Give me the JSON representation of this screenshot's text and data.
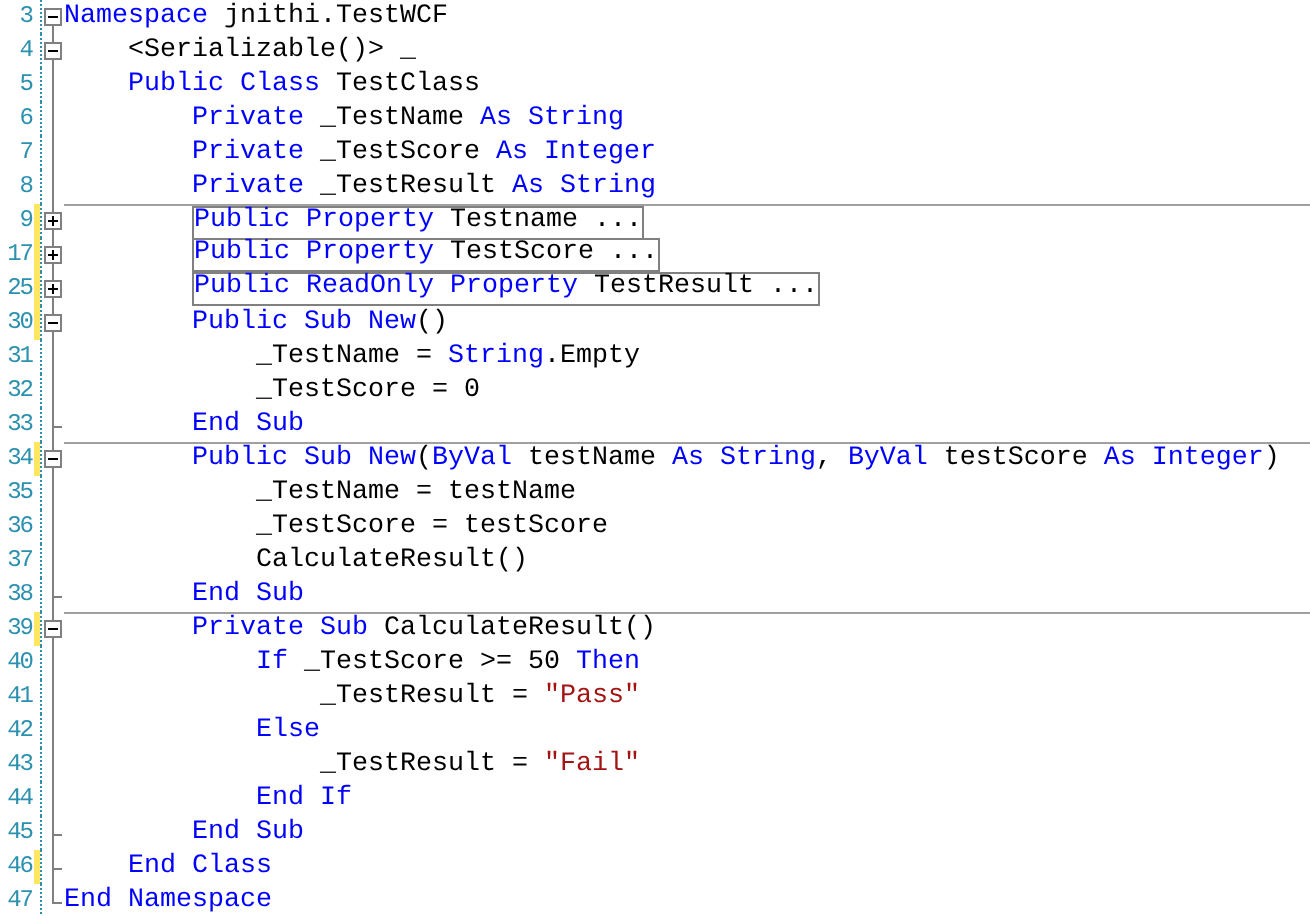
{
  "editor": {
    "lines": [
      {
        "number": "3",
        "kind": "open",
        "modified": false,
        "divider": false,
        "collapsed": false,
        "tokens": [
          {
            "kind": "keyword",
            "text": "Namespace"
          },
          {
            "kind": "plain",
            "text": " jnithi.TestWCF"
          }
        ]
      },
      {
        "number": "4",
        "kind": "open",
        "modified": false,
        "divider": false,
        "collapsed": false,
        "tokens": [
          {
            "kind": "plain",
            "text": "    <Serializable()> _"
          }
        ]
      },
      {
        "number": "5",
        "kind": "plain",
        "modified": false,
        "divider": false,
        "collapsed": false,
        "tokens": [
          {
            "kind": "keyword",
            "text": "    Public Class"
          },
          {
            "kind": "plain",
            "text": " TestClass"
          }
        ]
      },
      {
        "number": "6",
        "kind": "plain",
        "modified": false,
        "divider": false,
        "collapsed": false,
        "tokens": [
          {
            "kind": "keyword",
            "text": "        Private"
          },
          {
            "kind": "plain",
            "text": " _TestName "
          },
          {
            "kind": "keyword",
            "text": "As String"
          }
        ]
      },
      {
        "number": "7",
        "kind": "plain",
        "modified": false,
        "divider": false,
        "collapsed": false,
        "tokens": [
          {
            "kind": "keyword",
            "text": "        Private"
          },
          {
            "kind": "plain",
            "text": " _TestScore "
          },
          {
            "kind": "keyword",
            "text": "As Integer"
          }
        ]
      },
      {
        "number": "8",
        "kind": "plain",
        "modified": false,
        "divider": false,
        "collapsed": false,
        "tokens": [
          {
            "kind": "keyword",
            "text": "        Private"
          },
          {
            "kind": "plain",
            "text": " _TestResult "
          },
          {
            "kind": "keyword",
            "text": "As String"
          }
        ]
      },
      {
        "number": "9",
        "kind": "closed",
        "modified": true,
        "divider": true,
        "collapsed": true,
        "tokens": [
          {
            "kind": "keyword",
            "text": "        Public Property"
          },
          {
            "kind": "plain",
            "text": " Testname ..."
          }
        ]
      },
      {
        "number": "17",
        "kind": "closed",
        "modified": true,
        "divider": false,
        "collapsed": true,
        "tokens": [
          {
            "kind": "keyword",
            "text": "        Public Property"
          },
          {
            "kind": "plain",
            "text": " TestScore ..."
          }
        ]
      },
      {
        "number": "25",
        "kind": "closed",
        "modified": true,
        "divider": false,
        "collapsed": true,
        "tokens": [
          {
            "kind": "keyword",
            "text": "        Public ReadOnly Property"
          },
          {
            "kind": "plain",
            "text": " TestResult ..."
          }
        ]
      },
      {
        "number": "30",
        "kind": "open",
        "modified": true,
        "divider": false,
        "collapsed": false,
        "tokens": [
          {
            "kind": "keyword",
            "text": "        Public Sub New"
          },
          {
            "kind": "plain",
            "text": "()"
          }
        ]
      },
      {
        "number": "31",
        "kind": "plain",
        "modified": false,
        "divider": false,
        "collapsed": false,
        "tokens": [
          {
            "kind": "plain",
            "text": "            _TestName = "
          },
          {
            "kind": "keyword",
            "text": "String"
          },
          {
            "kind": "plain",
            "text": ".Empty"
          }
        ]
      },
      {
        "number": "32",
        "kind": "plain",
        "modified": false,
        "divider": false,
        "collapsed": false,
        "tokens": [
          {
            "kind": "plain",
            "text": "            _TestScore = 0"
          }
        ]
      },
      {
        "number": "33",
        "kind": "end",
        "modified": false,
        "divider": false,
        "collapsed": false,
        "tokens": [
          {
            "kind": "keyword",
            "text": "        End Sub"
          }
        ]
      },
      {
        "number": "34",
        "kind": "open",
        "modified": true,
        "divider": true,
        "collapsed": false,
        "tokens": [
          {
            "kind": "keyword",
            "text": "        Public Sub New"
          },
          {
            "kind": "plain",
            "text": "("
          },
          {
            "kind": "keyword",
            "text": "ByVal"
          },
          {
            "kind": "plain",
            "text": " testName "
          },
          {
            "kind": "keyword",
            "text": "As String"
          },
          {
            "kind": "plain",
            "text": ", "
          },
          {
            "kind": "keyword",
            "text": "ByVal"
          },
          {
            "kind": "plain",
            "text": " testScore "
          },
          {
            "kind": "keyword",
            "text": "As Integer"
          },
          {
            "kind": "plain",
            "text": ")"
          }
        ]
      },
      {
        "number": "35",
        "kind": "plain",
        "modified": false,
        "divider": false,
        "collapsed": false,
        "tokens": [
          {
            "kind": "plain",
            "text": "            _TestName = testName"
          }
        ]
      },
      {
        "number": "36",
        "kind": "plain",
        "modified": false,
        "divider": false,
        "collapsed": false,
        "tokens": [
          {
            "kind": "plain",
            "text": "            _TestScore = testScore"
          }
        ]
      },
      {
        "number": "37",
        "kind": "plain",
        "modified": false,
        "divider": false,
        "collapsed": false,
        "tokens": [
          {
            "kind": "plain",
            "text": "            CalculateResult()"
          }
        ]
      },
      {
        "number": "38",
        "kind": "end",
        "modified": false,
        "divider": false,
        "collapsed": false,
        "tokens": [
          {
            "kind": "keyword",
            "text": "        End Sub"
          }
        ]
      },
      {
        "number": "39",
        "kind": "open",
        "modified": true,
        "divider": true,
        "collapsed": false,
        "tokens": [
          {
            "kind": "keyword",
            "text": "        Private Sub"
          },
          {
            "kind": "plain",
            "text": " CalculateResult()"
          }
        ]
      },
      {
        "number": "40",
        "kind": "plain",
        "modified": false,
        "divider": false,
        "collapsed": false,
        "tokens": [
          {
            "kind": "keyword",
            "text": "            If"
          },
          {
            "kind": "plain",
            "text": " _TestScore >= 50 "
          },
          {
            "kind": "keyword",
            "text": "Then"
          }
        ]
      },
      {
        "number": "41",
        "kind": "plain",
        "modified": false,
        "divider": false,
        "collapsed": false,
        "tokens": [
          {
            "kind": "plain",
            "text": "                _TestResult = "
          },
          {
            "kind": "string",
            "text": "\"Pass\""
          }
        ]
      },
      {
        "number": "42",
        "kind": "plain",
        "modified": false,
        "divider": false,
        "collapsed": false,
        "tokens": [
          {
            "kind": "keyword",
            "text": "            Else"
          }
        ]
      },
      {
        "number": "43",
        "kind": "plain",
        "modified": false,
        "divider": false,
        "collapsed": false,
        "tokens": [
          {
            "kind": "plain",
            "text": "                _TestResult = "
          },
          {
            "kind": "string",
            "text": "\"Fail\""
          }
        ]
      },
      {
        "number": "44",
        "kind": "plain",
        "modified": false,
        "divider": false,
        "collapsed": false,
        "tokens": [
          {
            "kind": "keyword",
            "text": "            End If"
          }
        ]
      },
      {
        "number": "45",
        "kind": "end",
        "modified": false,
        "divider": false,
        "collapsed": false,
        "tokens": [
          {
            "kind": "keyword",
            "text": "        End Sub"
          }
        ]
      },
      {
        "number": "46",
        "kind": "end",
        "modified": true,
        "divider": false,
        "collapsed": false,
        "tokens": [
          {
            "kind": "keyword",
            "text": "    End Class"
          }
        ]
      },
      {
        "number": "47",
        "kind": "last",
        "modified": false,
        "divider": false,
        "collapsed": false,
        "tokens": [
          {
            "kind": "keyword",
            "text": "End Namespace"
          }
        ]
      }
    ]
  }
}
